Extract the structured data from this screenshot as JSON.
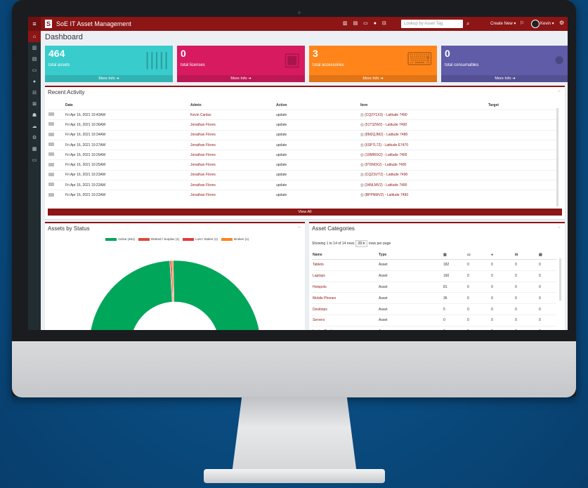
{
  "topbar": {
    "app_title": "SoE IT Asset Management",
    "lookup_placeholder": "Lookup by Asset Tag",
    "create_new_label": "Create New",
    "user_name": "Kevin",
    "header_bg_color": "#8c1515"
  },
  "page": {
    "title": "Dashboard"
  },
  "tiles": [
    {
      "count": "464",
      "label": "total assets",
      "more": "More Info",
      "color": "#39cccc",
      "icon": "barcode-icon"
    },
    {
      "count": "0",
      "label": "total licenses",
      "more": "More Info",
      "color": "#d81b60",
      "icon": "save-icon"
    },
    {
      "count": "3",
      "label": "total accessories",
      "more": "More Info",
      "color": "#ff851b",
      "icon": "keyboard-icon"
    },
    {
      "count": "0",
      "label": "total consumables",
      "more": "More Info",
      "color": "#605ca8",
      "icon": "drop-icon"
    }
  ],
  "recent_activity": {
    "title": "Recent Activity",
    "columns": [
      "Date",
      "Admin",
      "Action",
      "Item",
      "Target"
    ],
    "rows": [
      {
        "date": "Fri Apr 16, 2021 10:43AM",
        "admin": "Kevin Canlas",
        "action": "update",
        "item": "(CQ2Y1X3) - Latitude 7490"
      },
      {
        "date": "Fri Apr 16, 2021 10:36AM",
        "admin": "Jonathan Flores",
        "action": "update",
        "item": "(51T3ZW2) - Latitude 7490"
      },
      {
        "date": "Fri Apr 16, 2021 10:34AM",
        "admin": "Jonathan Flores",
        "action": "update",
        "item": "(8M2QJM2) - Latitude 7480"
      },
      {
        "date": "Fri Apr 16, 2021 10:27AM",
        "admin": "Jonathan Flores",
        "action": "update",
        "item": "(6SP7L72) - Latitude E7470"
      },
      {
        "date": "Fri Apr 16, 2021 10:26AM",
        "admin": "Jonathan Flores",
        "action": "update",
        "item": "(10MR0X2) - Latitude 7400"
      },
      {
        "date": "Fri Apr 16, 2021 10:25AM",
        "admin": "Jonathan Flores",
        "action": "update",
        "item": "(9T0N0X2) - Latitude 7400"
      },
      {
        "date": "Fri Apr 16, 2021 10:23AM",
        "admin": "Jonathan Flores",
        "action": "update",
        "item": "(CQZSVT2) - Latitude 7490"
      },
      {
        "date": "Fri Apr 16, 2021 10:22AM",
        "admin": "Jonathan Flores",
        "action": "update",
        "item": "(34NLMV2) - Latitude 7490"
      },
      {
        "date": "Fri Apr 16, 2021 10:22AM",
        "admin": "Jonathan Flores",
        "action": "update",
        "item": "(BPPNMV2) - Latitude 7490"
      }
    ],
    "view_all": "View All"
  },
  "assets_by_status": {
    "title": "Assets by Status",
    "chart_data": {
      "type": "pie",
      "labels": [
        "Active (461)",
        "Retired / Surplus (1)",
        "Lost / Stolen (1)",
        "Broken (1)"
      ],
      "values": [
        461,
        1,
        1,
        1
      ],
      "colors": [
        "#00a65a",
        "#dd4b39",
        "#e33a3a",
        "#ff851b"
      ],
      "legend_position": "top"
    }
  },
  "asset_categories": {
    "title": "Asset Categories",
    "showing": "Showing 1 to 14 of 14 rows",
    "per_page": "20",
    "per_page_suffix": "rows per page",
    "columns": [
      "Name",
      "Type"
    ],
    "rows": [
      {
        "name": "Tablets",
        "type": "Asset",
        "c1": "182",
        "c2": "0",
        "c3": "0",
        "c4": "0",
        "c5": "0"
      },
      {
        "name": "Laptops",
        "type": "Asset",
        "c1": "160",
        "c2": "0",
        "c3": "0",
        "c4": "0",
        "c5": "0"
      },
      {
        "name": "Hotspots",
        "type": "Asset",
        "c1": "81",
        "c2": "0",
        "c3": "0",
        "c4": "0",
        "c5": "0"
      },
      {
        "name": "Mobile Phones",
        "type": "Asset",
        "c1": "36",
        "c2": "0",
        "c3": "0",
        "c4": "0",
        "c5": "0"
      },
      {
        "name": "Desktops",
        "type": "Asset",
        "c1": "5",
        "c2": "0",
        "c3": "0",
        "c4": "0",
        "c5": "0"
      },
      {
        "name": "Servers",
        "type": "Asset",
        "c1": "0",
        "c2": "0",
        "c3": "0",
        "c4": "0",
        "c5": "0"
      },
      {
        "name": "Laptop Docks",
        "type": "Accessory",
        "c1": "0",
        "c2": "0",
        "c3": "0",
        "c4": "0",
        "c5": "0"
      }
    ]
  }
}
